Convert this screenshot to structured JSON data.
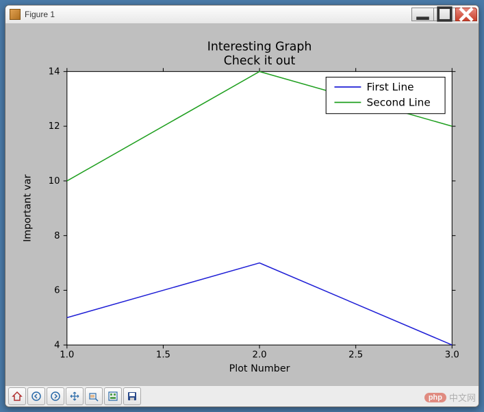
{
  "window": {
    "title": "Figure 1"
  },
  "watermark": {
    "logo": "php",
    "text": "中文网"
  },
  "toolbar": {
    "home": "Home",
    "back": "Back",
    "forward": "Forward",
    "pan": "Pan",
    "zoom": "Zoom",
    "subplots": "Configure",
    "save": "Save"
  },
  "chart_data": {
    "type": "line",
    "title": "Interesting Graph",
    "subtitle": "Check it out",
    "xlabel": "Plot Number",
    "ylabel": "Important var",
    "x": [
      1.0,
      2.0,
      3.0
    ],
    "xticks": [
      1.0,
      1.5,
      2.0,
      2.5,
      3.0
    ],
    "yticks": [
      4,
      6,
      8,
      10,
      12,
      14
    ],
    "xlim": [
      1.0,
      3.0
    ],
    "ylim": [
      4,
      14
    ],
    "series": [
      {
        "name": "First Line",
        "color": "#1f1fd6",
        "values": [
          5,
          7,
          4
        ]
      },
      {
        "name": "Second Line",
        "color": "#1f9f1f",
        "values": [
          10,
          14,
          12
        ]
      }
    ],
    "legend_position": "upper-right"
  }
}
